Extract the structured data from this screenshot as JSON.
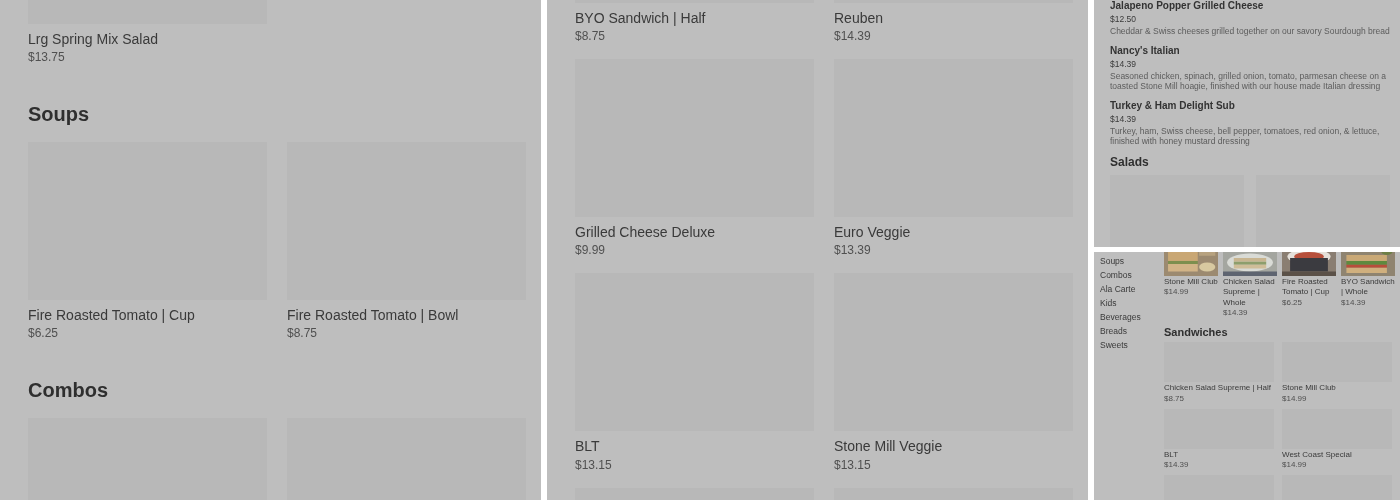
{
  "panels": [
    {
      "kind": "grid",
      "sections": [
        {
          "cards": [
            {
              "kind": "placeholder",
              "name": "Lrg Spring Mix Salad",
              "price": "$13.75"
            }
          ]
        },
        {
          "title": "Soups",
          "cards": [
            {
              "kind": "placeholder",
              "name": "Fire Roasted Tomato | Cup",
              "price": "$6.25"
            },
            {
              "kind": "placeholder",
              "name": "Fire Roasted Tomato | Bowl",
              "price": "$8.75"
            }
          ]
        },
        {
          "title": "Combos",
          "cards": [
            {
              "kind": "placeholder"
            },
            {
              "kind": "placeholder"
            }
          ]
        }
      ]
    },
    {
      "kind": "grid",
      "sections": [
        {
          "cards": [
            {
              "kind": "placeholder",
              "name": "BYO Sandwich | Half",
              "price": "$8.75"
            },
            {
              "kind": "placeholder",
              "name": "Reuben",
              "price": "$14.39"
            },
            {
              "kind": "placeholder",
              "name": "Grilled Cheese Deluxe",
              "price": "$9.99"
            },
            {
              "kind": "placeholder",
              "name": "Euro Veggie",
              "price": "$13.39"
            },
            {
              "kind": "placeholder",
              "name": "BLT",
              "price": "$13.15"
            },
            {
              "kind": "placeholder",
              "name": "Stone Mill Veggie",
              "price": "$13.15"
            },
            {
              "kind": "placeholder"
            },
            {
              "kind": "placeholder"
            }
          ]
        }
      ]
    },
    {
      "kind": "list",
      "items": [
        {
          "name": "Jalapeno Popper Grilled Cheese",
          "price": "$12.50",
          "description": "Cheddar & Swiss cheeses grilled together on our savory Sourdough bread"
        },
        {
          "name": "Nancy's Italian",
          "price": "$14.39",
          "description": "Seasoned chicken, spinach, grilled onion, tomato, parmesan cheese on a toasted Stone Mill hoagie, finished with our house made Italian dressing"
        },
        {
          "name": "Turkey & Ham Delight Sub",
          "price": "$14.39",
          "description": "Turkey, ham, Swiss cheese, bell pepper, tomatoes, red onion, & lettuce, finished with honey mustard dressing"
        }
      ],
      "sections": [
        {
          "title": "Salads",
          "cards": [
            {
              "kind": "placeholder"
            },
            {
              "kind": "placeholder"
            }
          ]
        }
      ]
    },
    {
      "kind": "store",
      "sidebar": [
        "Soups",
        "Combos",
        "Ala Carte",
        "Kids",
        "Beverages",
        "Breads",
        "Sweets"
      ],
      "featured": [
        {
          "kind": "picture",
          "name": "Stone Mill Club",
          "price": "$14.99"
        },
        {
          "kind": "picture",
          "name": "Chicken Salad Supreme | Whole",
          "price": "$14.39"
        },
        {
          "kind": "picture",
          "name": "Fire Roasted Tomato | Cup",
          "price": "$6.25"
        },
        {
          "kind": "picture",
          "name": "BYO Sandwich | Whole",
          "price": "$14.39"
        }
      ],
      "sections": [
        {
          "title": "Sandwiches",
          "cards": [
            {
              "kind": "placeholder",
              "name": "Chicken Salad Supreme | Half",
              "price": "$8.75"
            },
            {
              "kind": "placeholder",
              "name": "Stone Mill Club",
              "price": "$14.99"
            },
            {
              "kind": "placeholder",
              "name": "BLT",
              "price": "$14.39"
            },
            {
              "kind": "placeholder",
              "name": "West Coast Special",
              "price": "$14.99"
            },
            {
              "kind": "placeholder"
            },
            {
              "kind": "placeholder"
            }
          ]
        }
      ]
    }
  ]
}
